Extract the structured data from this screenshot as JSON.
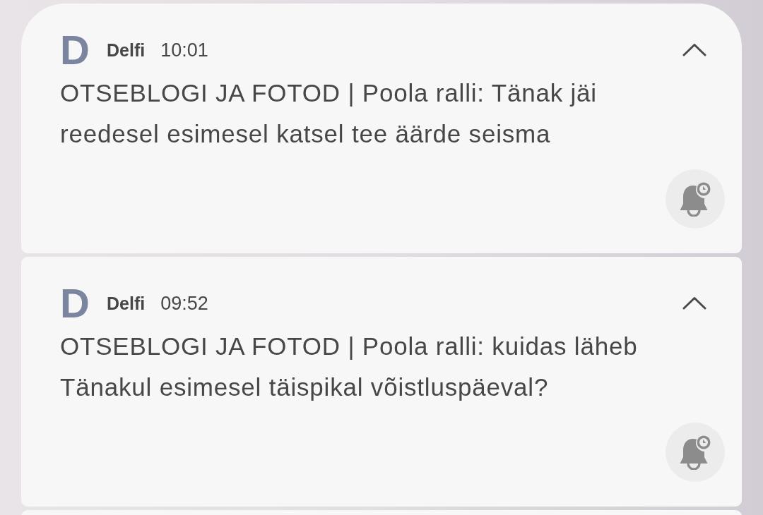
{
  "notifications": [
    {
      "logo": "D",
      "app": "Delfi",
      "time": "10:01",
      "title": "OTSEBLOGI JA FOTOD | Poola ralli: Tänak jäi reedesel esimesel katsel tee äärde seisma",
      "expanded": true
    },
    {
      "logo": "D",
      "app": "Delfi",
      "time": "09:52",
      "title": "OTSEBLOGI JA FOTOD | Poola ralli: kuidas läheb Tänakul esimesel täispikal võistluspäeval?",
      "expanded": true
    }
  ]
}
